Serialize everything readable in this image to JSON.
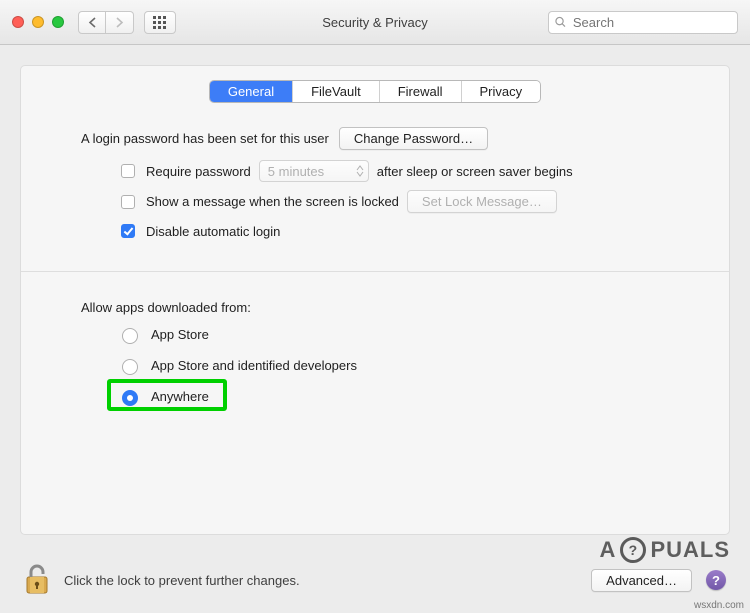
{
  "window": {
    "title": "Security & Privacy"
  },
  "toolbar": {
    "search_placeholder": "Search"
  },
  "tabs": {
    "general": "General",
    "filevault": "FileVault",
    "firewall": "Firewall",
    "privacy": "Privacy",
    "active": "general"
  },
  "login": {
    "password_set_text": "A login password has been set for this user",
    "change_password_btn": "Change Password…",
    "require_password_label": "Require password",
    "require_password_select": "5 minutes",
    "require_password_tail": "after sleep or screen saver begins",
    "show_message_label": "Show a message when the screen is locked",
    "set_lock_message_btn": "Set Lock Message…",
    "disable_auto_login_label": "Disable automatic login"
  },
  "downloads": {
    "heading": "Allow apps downloaded from:",
    "options": {
      "appstore": "App Store",
      "identified": "App Store and identified developers",
      "anywhere": "Anywhere"
    },
    "selected": "anywhere"
  },
  "footer": {
    "lock_text": "Click the lock to prevent further changes.",
    "advanced_btn": "Advanced…"
  },
  "meta": {
    "watermark": "A?PUALS",
    "source": "wsxdn.com"
  }
}
